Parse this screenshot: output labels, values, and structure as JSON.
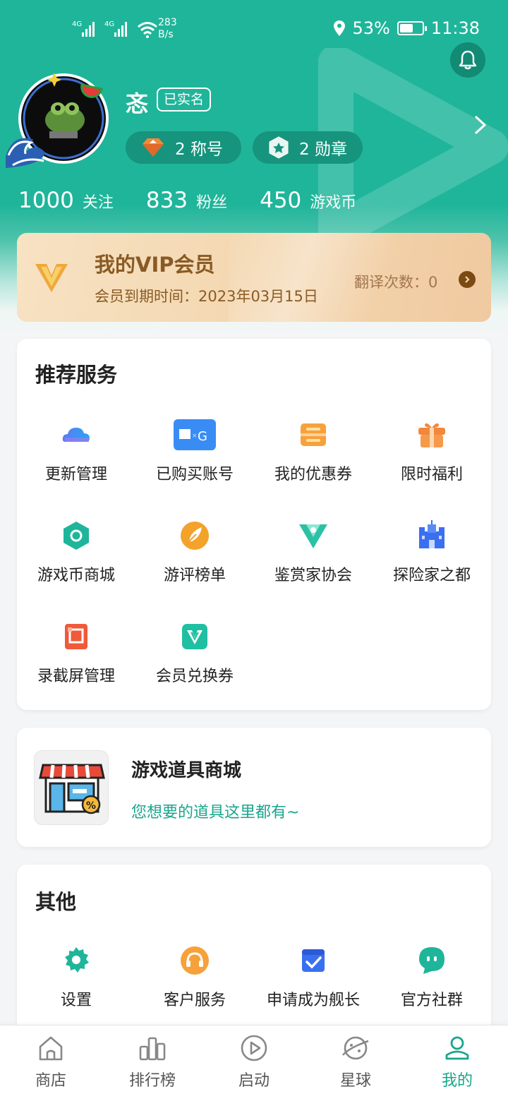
{
  "status_bar": {
    "network": "4G",
    "network2": "4G",
    "speed_value": "283",
    "speed_unit": "B/s",
    "battery": "53%",
    "time": "11:38"
  },
  "profile": {
    "name": "忞",
    "verified_badge": "已实名",
    "titles": "2 称号",
    "medals": "2 勋章",
    "stats": [
      {
        "value": "1000",
        "label": "关注"
      },
      {
        "value": "833",
        "label": "粉丝"
      },
      {
        "value": "450",
        "label": "游戏币"
      }
    ]
  },
  "vip": {
    "title": "我的VIP会员",
    "expiry": "会员到期时间：2023年03月15日",
    "translation_count": "翻译次数：0"
  },
  "recommended": {
    "title": "推荐服务",
    "items": [
      {
        "label": "更新管理",
        "icon": "cloud-icon"
      },
      {
        "label": "已购买账号",
        "icon": "account-icon"
      },
      {
        "label": "我的优惠券",
        "icon": "coupon-icon"
      },
      {
        "label": "限时福利",
        "icon": "gift-icon"
      },
      {
        "label": "游戏币商城",
        "icon": "coin-shop-icon"
      },
      {
        "label": "游评榜单",
        "icon": "review-rank-icon"
      },
      {
        "label": "鉴赏家协会",
        "icon": "connoisseur-icon"
      },
      {
        "label": "探险家之都",
        "icon": "castle-icon"
      },
      {
        "label": "录截屏管理",
        "icon": "screenshot-icon"
      },
      {
        "label": "会员兑换券",
        "icon": "vip-voucher-icon"
      }
    ]
  },
  "item_shop": {
    "title": "游戏道具商城",
    "subtitle": "您想要的道具这里都有~"
  },
  "others": {
    "title": "其他",
    "items": [
      {
        "label": "设置",
        "icon": "gear-icon"
      },
      {
        "label": "客户服务",
        "icon": "headset-icon"
      },
      {
        "label": "申请成为舰长",
        "icon": "apply-icon"
      },
      {
        "label": "官方社群",
        "icon": "chat-icon"
      }
    ]
  },
  "tabbar": {
    "items": [
      {
        "label": "商店",
        "icon": "store-icon"
      },
      {
        "label": "排行榜",
        "icon": "ranking-icon"
      },
      {
        "label": "启动",
        "icon": "play-icon"
      },
      {
        "label": "星球",
        "icon": "planet-icon"
      },
      {
        "label": "我的",
        "icon": "user-icon"
      }
    ],
    "active": "我的"
  },
  "colors": {
    "brand": "#1fb59a",
    "brand_dark": "#17947d",
    "vip_text": "#8a5a24"
  }
}
